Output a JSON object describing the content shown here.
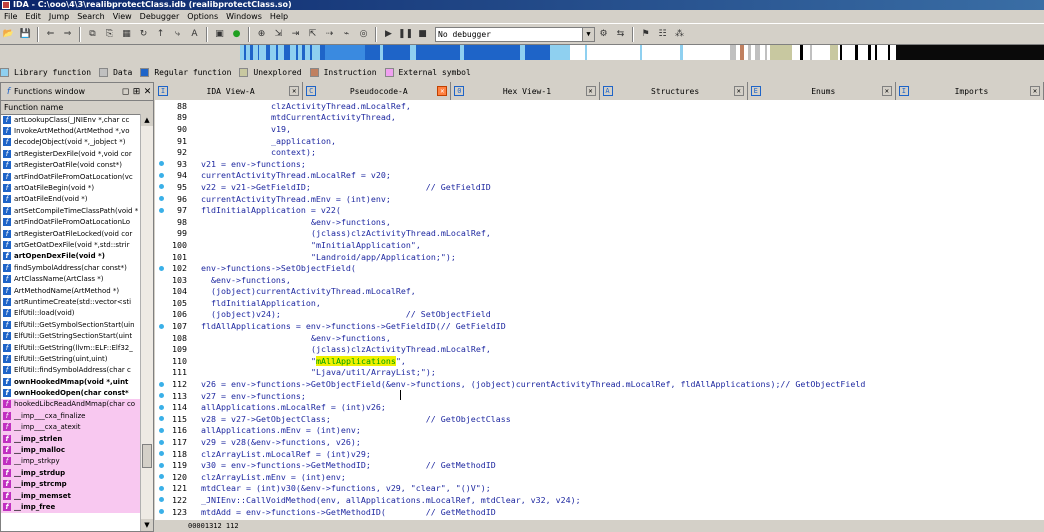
{
  "window": {
    "title": "IDA - C:\\ooo\\4\\3\\realibprotectClass.idb (realibprotectClass.so)"
  },
  "menu": [
    "File",
    "Edit",
    "Jump",
    "Search",
    "View",
    "Debugger",
    "Options",
    "Windows",
    "Help"
  ],
  "toolbar": {
    "debugger_select": "No debugger"
  },
  "legend": [
    {
      "label": "Library function",
      "color": "#8fd0f0"
    },
    {
      "label": "Data",
      "color": "#c0c0c0"
    },
    {
      "label": "Regular function",
      "color": "#1e64c8"
    },
    {
      "label": "Unexplored",
      "color": "#c8c8a0"
    },
    {
      "label": "Instruction",
      "color": "#c08060"
    },
    {
      "label": "External symbol",
      "color": "#f0a0f0"
    }
  ],
  "functions_window": {
    "title": "Functions window",
    "column_header": "Function name",
    "items": [
      {
        "label": "artLookupClass(_JNIEnv *,char cc",
        "style": ""
      },
      {
        "label": "InvokeArtMethod(ArtMethod *,vo",
        "style": ""
      },
      {
        "label": "decodeJObject(void *,_jobject *)",
        "style": ""
      },
      {
        "label": "artRegisterDexFile(void *,void cor",
        "style": ""
      },
      {
        "label": "artRegisterOatFile(void const*)",
        "style": ""
      },
      {
        "label": "artFindOatFileFromOatLocation(vc",
        "style": ""
      },
      {
        "label": "artOatFileBegin(void *)",
        "style": ""
      },
      {
        "label": "artOatFileEnd(void *)",
        "style": ""
      },
      {
        "label": "artSetCompileTimeClassPath(void *",
        "style": ""
      },
      {
        "label": "artFindOatFileFromOatLocationLo",
        "style": ""
      },
      {
        "label": "artRegisterOatFileLocked(void cor",
        "style": ""
      },
      {
        "label": "artGetOatDexFile(void *,std::strir",
        "style": ""
      },
      {
        "label": "artOpenDexFile(void *)",
        "style": "bold"
      },
      {
        "label": "findSymbolAddress(char const*)",
        "style": ""
      },
      {
        "label": "ArtClassName(ArtClass *)",
        "style": ""
      },
      {
        "label": "ArtMethodName(ArtMethod *)",
        "style": ""
      },
      {
        "label": "artRuntimeCreate(std::vector<sti",
        "style": ""
      },
      {
        "label": "ElfUtil::load(void)",
        "style": ""
      },
      {
        "label": "ElfUtil::GetSymbolSectionStart(uin",
        "style": ""
      },
      {
        "label": "ElfUtil::GetStringSectionStart(uint",
        "style": ""
      },
      {
        "label": "ElfUtil::GetString(llvm::ELF::Elf32_",
        "style": ""
      },
      {
        "label": "ElfUtil::GetString(uint,uint)",
        "style": ""
      },
      {
        "label": "ElfUtil::findSymbolAddress(char c",
        "style": ""
      },
      {
        "label": "ownHookedMmap(void *,uint",
        "style": "bold"
      },
      {
        "label": "ownHookedOpen(char const*",
        "style": "bold"
      },
      {
        "label": "hookedLibcReadAndMmap(char co",
        "style": "pink"
      },
      {
        "label": "__imp___cxa_finalize",
        "style": "pink"
      },
      {
        "label": "__imp___cxa_atexit",
        "style": "pink"
      },
      {
        "label": "__imp_strlen",
        "style": "pink bold"
      },
      {
        "label": "__imp_malloc",
        "style": "pink bold"
      },
      {
        "label": "__imp_strkpy",
        "style": "pink"
      },
      {
        "label": "__imp_strdup",
        "style": "pink bold"
      },
      {
        "label": "__imp_strcmp",
        "style": "pink bold"
      },
      {
        "label": "__imp_memset",
        "style": "pink bold"
      },
      {
        "label": "__imp_free",
        "style": "pink bold"
      }
    ]
  },
  "tabs": [
    {
      "label": "IDA View-A",
      "icon": "IDA",
      "active": false
    },
    {
      "label": "Pseudocode-A",
      "icon": "C",
      "active": true
    },
    {
      "label": "Hex View-1",
      "icon": "0x",
      "active": false
    },
    {
      "label": "Structures",
      "icon": "A",
      "active": false
    },
    {
      "label": "Enums",
      "icon": "En",
      "active": false
    },
    {
      "label": "Imports",
      "icon": "Im",
      "active": false
    }
  ],
  "code_lines": [
    {
      "ln": "88",
      "dot": false,
      "indent": 14,
      "text": "clzActivityThread.mLocalRef,"
    },
    {
      "ln": "89",
      "dot": false,
      "indent": 14,
      "text": "mtdCurrentActivityThread,"
    },
    {
      "ln": "90",
      "dot": false,
      "indent": 14,
      "text": "v19,"
    },
    {
      "ln": "91",
      "dot": false,
      "indent": 14,
      "text": "_application,"
    },
    {
      "ln": "92",
      "dot": false,
      "indent": 14,
      "text": "context);"
    },
    {
      "ln": "93",
      "dot": true,
      "indent": 0,
      "text": "v21 = env->functions;"
    },
    {
      "ln": "94",
      "dot": true,
      "indent": 0,
      "text": "currentActivityThread.mLocalRef = v20;"
    },
    {
      "ln": "95",
      "dot": true,
      "indent": 0,
      "text": "v22 = v21->GetFieldID;                       // GetFieldID"
    },
    {
      "ln": "96",
      "dot": true,
      "indent": 0,
      "text": "currentActivityThread.mEnv = (int)env;"
    },
    {
      "ln": "97",
      "dot": true,
      "indent": 0,
      "text": "fldInitialApplication = v22("
    },
    {
      "ln": "98",
      "dot": false,
      "indent": 22,
      "text": "&env->functions,"
    },
    {
      "ln": "99",
      "dot": false,
      "indent": 22,
      "text": "(jclass)clzActivityThread.mLocalRef,"
    },
    {
      "ln": "100",
      "dot": false,
      "indent": 22,
      "text": "\"mInitialApplication\","
    },
    {
      "ln": "101",
      "dot": false,
      "indent": 22,
      "text": "\"Landroid/app/Application;\");"
    },
    {
      "ln": "102",
      "dot": true,
      "indent": 0,
      "text": "env->functions->SetObjectField("
    },
    {
      "ln": "103",
      "dot": false,
      "indent": 2,
      "text": "&env->functions,"
    },
    {
      "ln": "104",
      "dot": false,
      "indent": 2,
      "text": "(jobject)currentActivityThread.mLocalRef,"
    },
    {
      "ln": "105",
      "dot": false,
      "indent": 2,
      "text": "fldInitialApplication,"
    },
    {
      "ln": "106",
      "dot": false,
      "indent": 2,
      "text": "(jobject)v24);                         // SetObjectField"
    },
    {
      "ln": "107",
      "dot": true,
      "indent": 0,
      "text": "fldAllApplications = env->functions->GetFieldID(// GetFieldID"
    },
    {
      "ln": "108",
      "dot": false,
      "indent": 22,
      "text": "&env->functions,"
    },
    {
      "ln": "109",
      "dot": false,
      "indent": 22,
      "text": "(jclass)clzActivityThread.mLocalRef,"
    },
    {
      "ln": "110",
      "dot": false,
      "indent": 22,
      "text": "\"mAllApplications\",",
      "highlight": "mAllApplications"
    },
    {
      "ln": "111",
      "dot": false,
      "indent": 22,
      "text": "\"Ljava/util/ArrayList;\");"
    },
    {
      "ln": "112",
      "dot": true,
      "indent": 0,
      "text": "v26 = env->functions->GetObjectField(&env->functions, (jobject)currentActivityThread.mLocalRef, fldAllApplications);// GetObjectField"
    },
    {
      "ln": "113",
      "dot": true,
      "indent": 0,
      "text": "v27 = env->functions;"
    },
    {
      "ln": "114",
      "dot": true,
      "indent": 0,
      "text": "allApplications.mLocalRef = (int)v26;"
    },
    {
      "ln": "115",
      "dot": true,
      "indent": 0,
      "text": "v28 = v27->GetObjectClass;                   // GetObjectClass"
    },
    {
      "ln": "116",
      "dot": true,
      "indent": 0,
      "text": "allApplications.mEnv = (int)env;"
    },
    {
      "ln": "117",
      "dot": true,
      "indent": 0,
      "text": "v29 = v28(&env->functions, v26);"
    },
    {
      "ln": "118",
      "dot": true,
      "indent": 0,
      "text": "clzArrayList.mLocalRef = (int)v29;"
    },
    {
      "ln": "119",
      "dot": true,
      "indent": 0,
      "text": "v30 = env->functions->GetMethodID;           // GetMethodID"
    },
    {
      "ln": "120",
      "dot": true,
      "indent": 0,
      "text": "clzArrayList.mEnv = (int)env;"
    },
    {
      "ln": "121",
      "dot": true,
      "indent": 0,
      "text": "mtdClear = (int)v30(&env->functions, v29, \"clear\", \"()V\");"
    },
    {
      "ln": "122",
      "dot": true,
      "indent": 0,
      "text": "_JNIEnv::CallVoidMethod(env, allApplications.mLocalRef, mtdClear, v32, v24);"
    },
    {
      "ln": "123",
      "dot": true,
      "indent": 0,
      "text": "mtdAdd = env->functions->GetMethodID(        // GetMethodID"
    }
  ],
  "status": {
    "text": "00001312 112"
  }
}
